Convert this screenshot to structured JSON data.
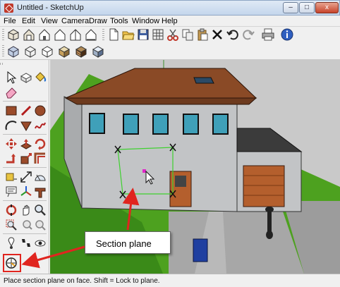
{
  "window": {
    "title": "Untitled - SketchUp",
    "minimize_glyph": "–",
    "maximize_glyph": "□",
    "close_glyph": "x"
  },
  "menu": [
    "File",
    "Edit",
    "View",
    "Camera",
    "Draw",
    "Tools",
    "Window",
    "Help"
  ],
  "toolbar_views": [
    "iso-view-icon",
    "top-view-icon",
    "front-view-icon",
    "right-view-icon",
    "back-view-icon",
    "left-view-icon"
  ],
  "toolbar_standard": [
    "new-file-icon",
    "open-file-icon",
    "save-icon",
    "make-component-icon",
    "cut-icon",
    "copy-icon",
    "paste-icon",
    "erase-icon",
    "undo-icon",
    "redo-icon",
    "print-icon",
    "model-info-icon"
  ],
  "toolbar_styles": [
    "xray-icon",
    "wireframe-icon",
    "hidden-line-icon",
    "shaded-icon",
    "shaded-textures-icon",
    "monochrome-icon"
  ],
  "left_tools": [
    "select-icon",
    "make-component-icon",
    "paint-bucket-icon",
    "eraser-icon",
    "rectangle-icon",
    "line-icon",
    "circle-icon",
    "arc-icon",
    "polygon-icon",
    "freehand-icon",
    "move-icon",
    "push-pull-icon",
    "rotate-icon",
    "follow-me-icon",
    "scale-icon",
    "offset-icon",
    "tape-measure-icon",
    "dimension-icon",
    "protractor-icon",
    "text-icon",
    "axes-icon",
    "3d-text-icon",
    "orbit-icon",
    "pan-icon",
    "zoom-icon",
    "zoom-window-icon",
    "previous-view-icon",
    "zoom-extents-icon",
    "position-camera-icon",
    "walk-icon",
    "look-around-icon",
    "section-plane-icon"
  ],
  "callout": {
    "label": "Section plane"
  },
  "status": {
    "text": "Place section plane on face.  Shift = Lock to plane."
  },
  "colors": {
    "sky": "#c9c9c9",
    "grass": "#4da11f",
    "roof": "#8a4a26",
    "wall": "#c2c4c6",
    "window": "#3fa0b9",
    "garage_door": "#b45f2d",
    "section_plane": "#3ed12f",
    "callout_arrow": "#e0251f"
  }
}
